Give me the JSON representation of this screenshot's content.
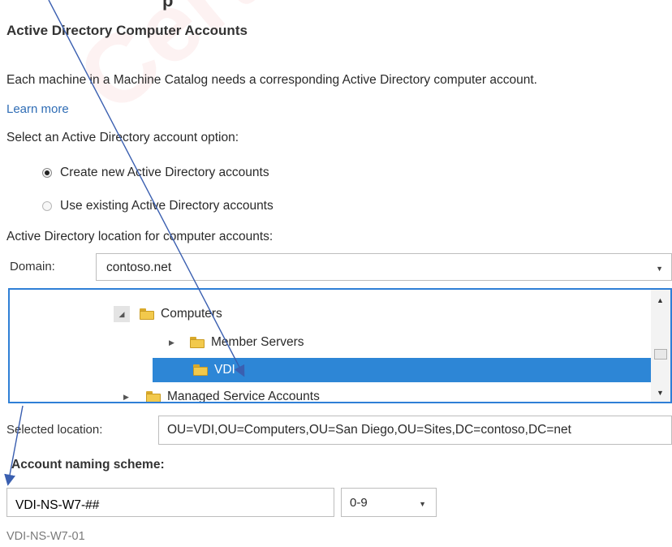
{
  "page": {
    "top_heading_fragment": "p"
  },
  "section": {
    "title": "Active Directory Computer Accounts",
    "description": "Each machine in a Machine Catalog needs a corresponding Active Directory computer account.",
    "learn_more": "Learn more"
  },
  "account_option": {
    "label": "Select an Active Directory account option:",
    "options": [
      {
        "label": "Create new Active Directory accounts",
        "selected": true
      },
      {
        "label": "Use existing Active Directory accounts",
        "selected": false
      }
    ]
  },
  "location": {
    "label": "Active Directory location for computer accounts:",
    "domain_label": "Domain:",
    "domain_value": "contoso.net"
  },
  "tree": {
    "items": [
      {
        "label": "Computers",
        "expanded": true,
        "icon": "folder-icon"
      },
      {
        "label": "Member Servers",
        "expanded": false,
        "icon": "folder-icon"
      },
      {
        "label": "VDI",
        "selected": true,
        "icon": "folder-icon"
      },
      {
        "label": "Managed Service Accounts",
        "expanded": false,
        "icon": "folder-icon"
      }
    ]
  },
  "selected_location": {
    "label": "Selected location:",
    "value": "OU=VDI,OU=Computers,OU=San Diego,OU=Sites,DC=contoso,DC=net"
  },
  "naming": {
    "label": "Account naming scheme:",
    "value": "VDI-NS-W7-##",
    "range_value": "0-9",
    "preview": "VDI-NS-W7-01"
  },
  "watermark": {
    "text": "CertKillers",
    "color": "#d62828"
  },
  "annotation": {
    "arrow_color": "#3a5fb0"
  }
}
